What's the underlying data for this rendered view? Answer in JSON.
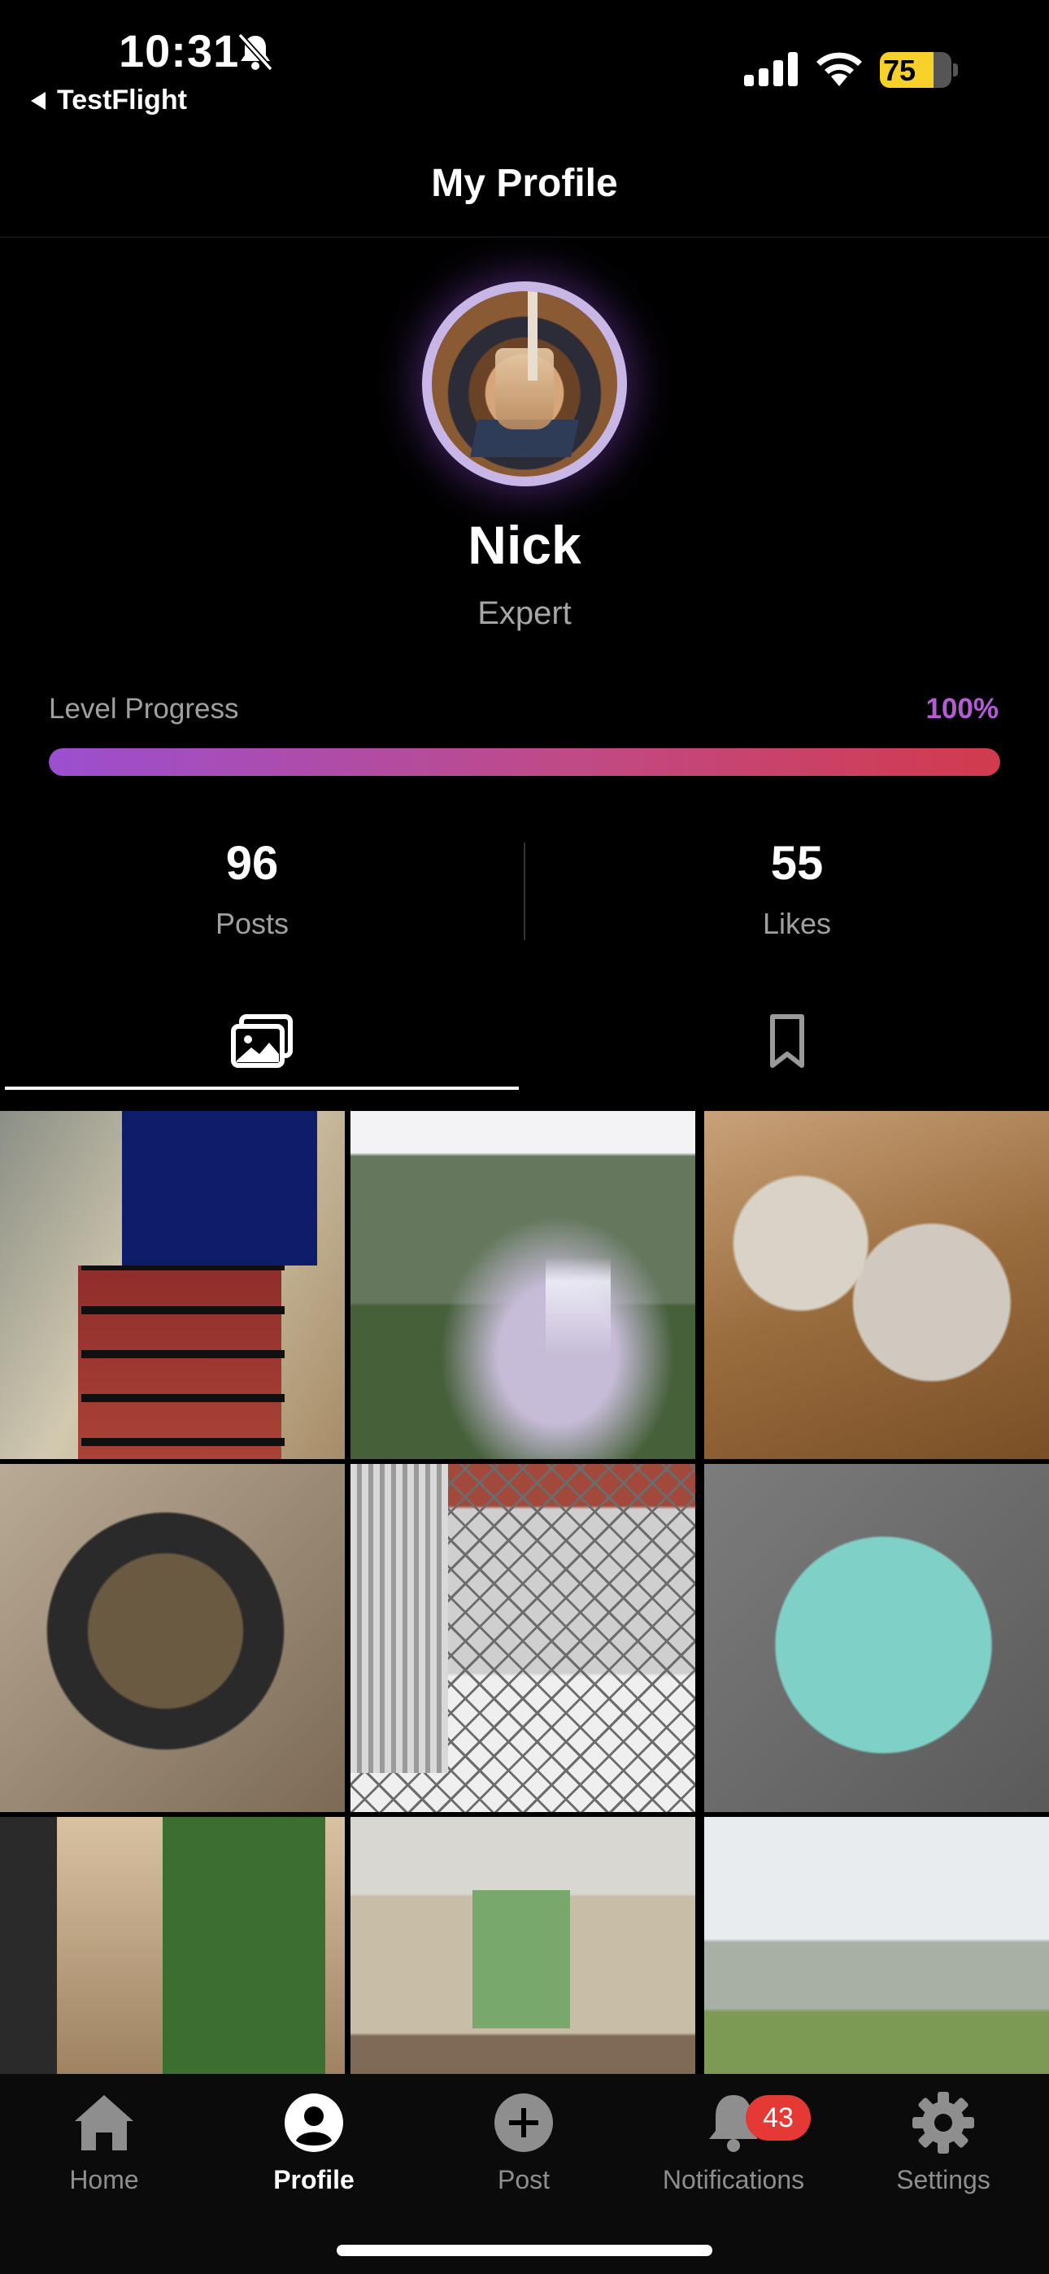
{
  "status_bar": {
    "time": "10:31",
    "back_app": "TestFlight",
    "battery_percent": "75",
    "battery_level": 0.75,
    "battery_color": "#f7d02a",
    "icons": [
      "bell-slash-icon",
      "cellular-signal-icon",
      "wifi-icon",
      "battery-charging-icon"
    ]
  },
  "header": {
    "title": "My Profile"
  },
  "profile": {
    "name": "Nick",
    "title": "Expert",
    "avatar_icon": "avatar-photo"
  },
  "level": {
    "label": "Level Progress",
    "percent_text": "100%",
    "progress": 1.0,
    "accent_color": "#b65ad8",
    "gradient": [
      "#9b4fd0",
      "#c04a86",
      "#d23a4d"
    ]
  },
  "stats": {
    "posts": {
      "value": "96",
      "label": "Posts"
    },
    "likes": {
      "value": "55",
      "label": "Likes"
    }
  },
  "tabs": [
    {
      "icon": "photos-icon",
      "active": true
    },
    {
      "icon": "bookmark-icon",
      "active": false
    }
  ],
  "grid": {
    "photos": [
      {
        "icon": "photo-chocolate-box"
      },
      {
        "icon": "photo-waterfall"
      },
      {
        "icon": "photo-ceramic-jars"
      },
      {
        "icon": "photo-hotpot"
      },
      {
        "icon": "photo-balcony-railing"
      },
      {
        "icon": "photo-food-platter"
      },
      {
        "icon": "photo-cafe-interior"
      },
      {
        "icon": "photo-cafe-room"
      },
      {
        "icon": "photo-grass-flower"
      }
    ]
  },
  "bottom_nav": {
    "items": [
      {
        "label": "Home",
        "icon": "home-icon",
        "active": false
      },
      {
        "label": "Profile",
        "icon": "profile-icon",
        "active": true
      },
      {
        "label": "Post",
        "icon": "plus-circle-icon",
        "active": false
      },
      {
        "label": "Notifications",
        "icon": "bell-icon",
        "active": false,
        "badge": "43"
      },
      {
        "label": "Settings",
        "icon": "gear-icon",
        "active": false
      }
    ],
    "badge_color": "#e53935"
  }
}
